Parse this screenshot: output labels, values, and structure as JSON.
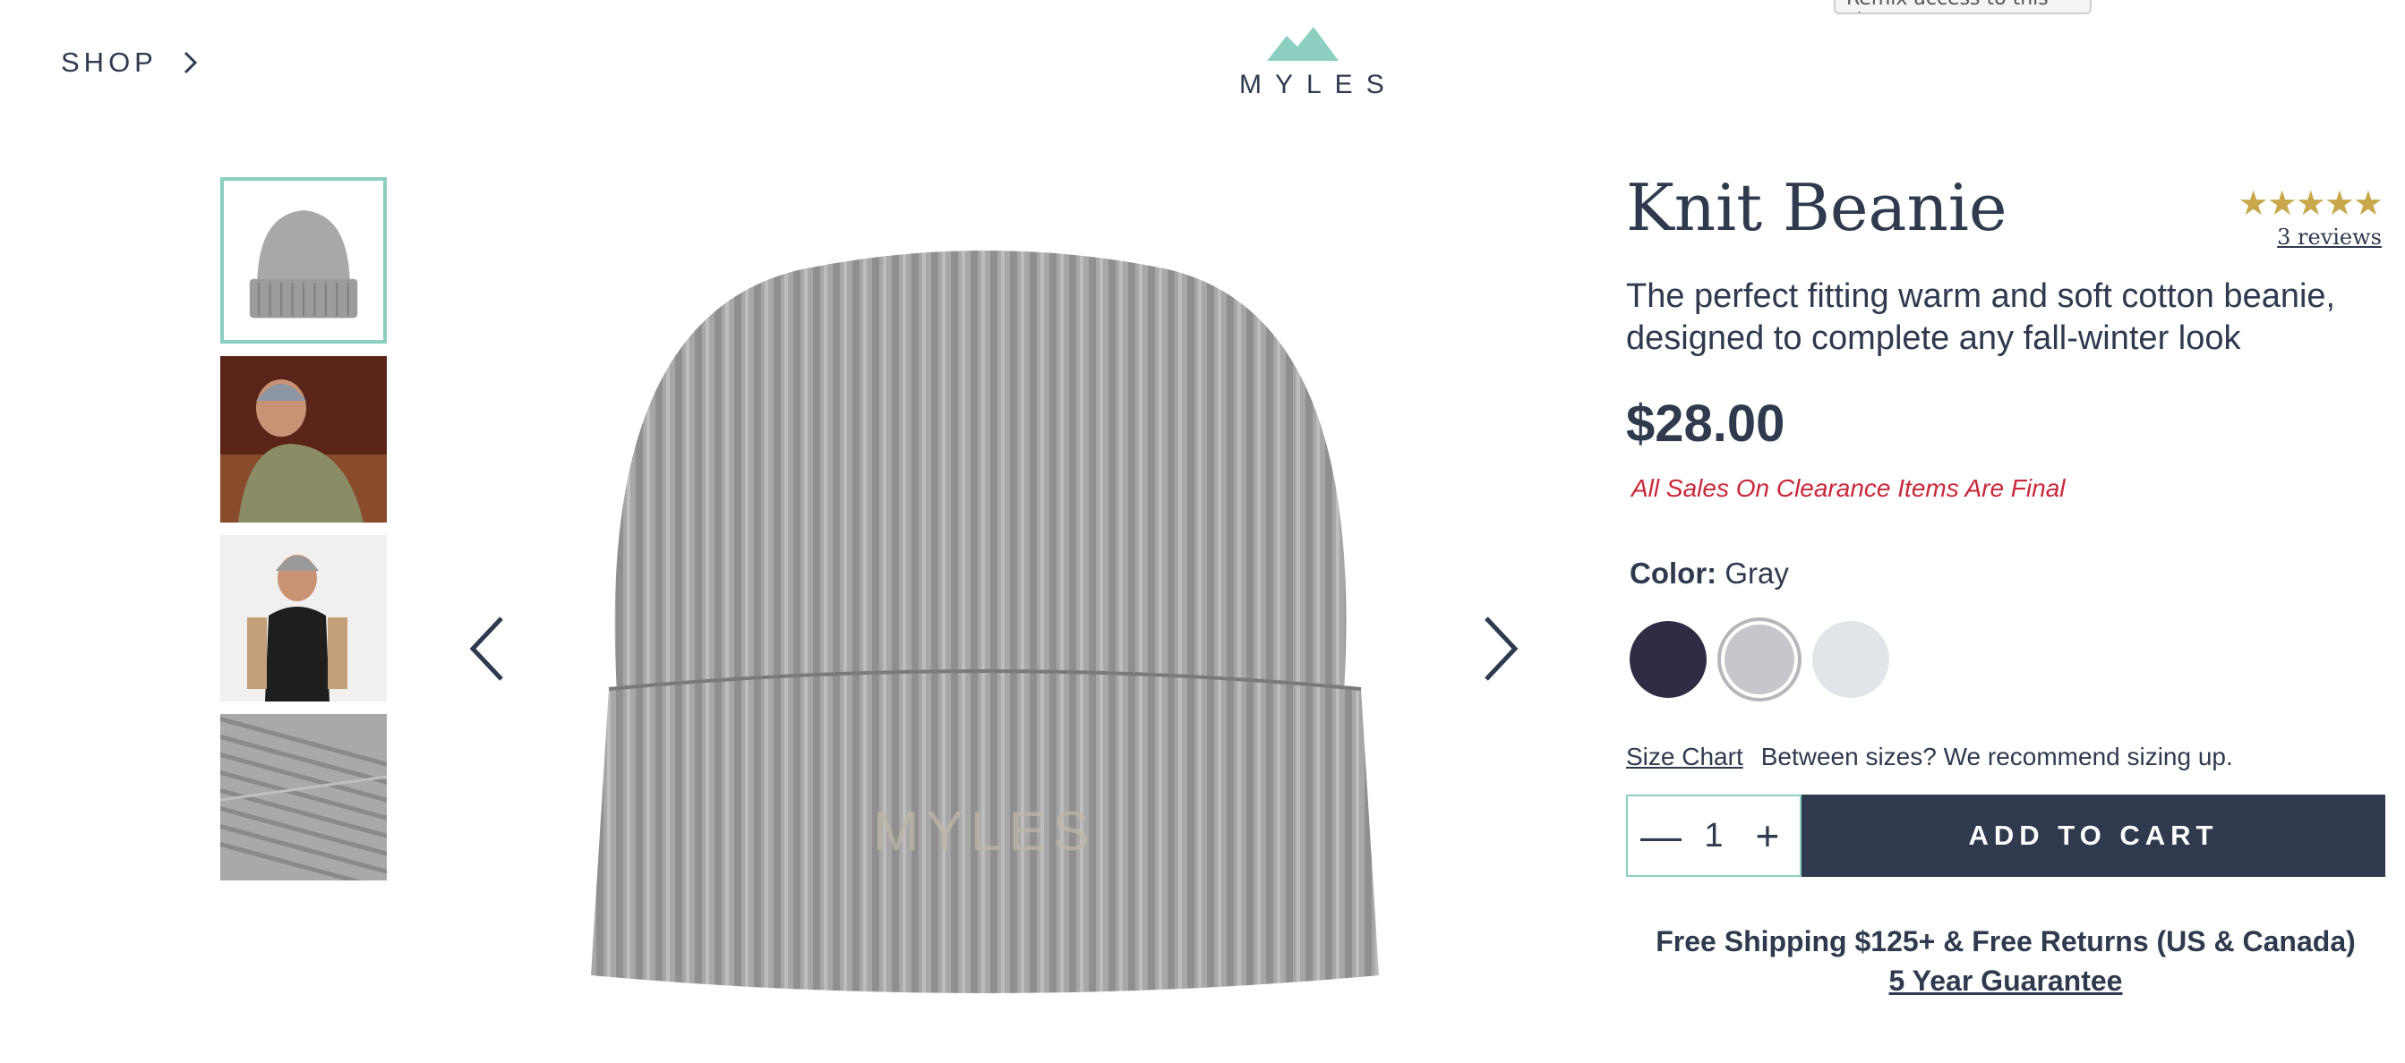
{
  "tooltip": {
    "text": "Remix access to this site"
  },
  "header": {
    "shop_label": "SHOP",
    "logo_text": "MYLES",
    "logo_color": "#8ccfc0"
  },
  "gallery": {
    "thumbnails": [
      {
        "alt": "Gray knit beanie product shot"
      },
      {
        "alt": "Model wearing beanie outdoors"
      },
      {
        "alt": "Model wearing beanie and vest"
      },
      {
        "alt": "Close-up of knit texture"
      }
    ],
    "prev_label": "previous-image",
    "next_label": "next-image",
    "embroidery": "MYLES"
  },
  "product": {
    "title": "Knit Beanie",
    "stars": "★★★★★",
    "rating_value": 5,
    "reviews": "3 reviews",
    "description": "The perfect fitting warm and soft cotton beanie, designed to complete any fall-winter look",
    "price": "$28.00",
    "clearance_note": "All Sales On Clearance Items Are Final",
    "color_label": "Color:",
    "color_value": "Gray",
    "swatches": [
      {
        "name": "Navy",
        "hex": "#2f2d45"
      },
      {
        "name": "Gray",
        "hex": "#c8c6cc",
        "selected": true
      },
      {
        "name": "Light Blue",
        "hex": "#dfe5e8"
      }
    ],
    "size_chart_label": "Size Chart",
    "size_note": "Between sizes? We recommend sizing up.",
    "quantity": "1",
    "qty_minus": "—",
    "qty_plus": "+",
    "add_to_cart": "ADD TO CART",
    "shipping_line": "Free Shipping $125+ & Free Returns (US & Canada)",
    "guarantee_line": "5 Year Guarantee"
  },
  "colors": {
    "text": "#2f3a4f",
    "accent": "#8ccfc0",
    "star": "#c9a84c",
    "clearance": "#c8283a",
    "button": "#2f3a4f"
  }
}
